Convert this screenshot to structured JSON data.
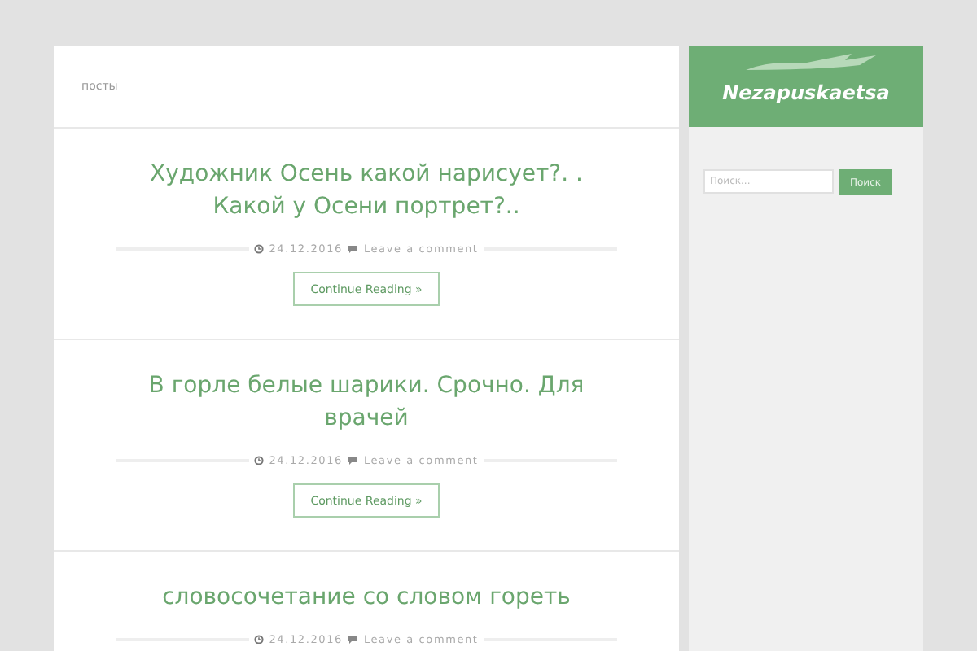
{
  "header": {
    "breadcrumb": "посты"
  },
  "posts": [
    {
      "title": "Художник Осень какой нарисует?. . Какой у Осени портрет?..",
      "date": "24.12.2016",
      "comments": "Leave a comment",
      "button": "Continue Reading »"
    },
    {
      "title": "В горле белые шарики. Срочно. Для врачей",
      "date": "24.12.2016",
      "comments": "Leave a comment",
      "button": "Continue Reading »"
    },
    {
      "title": "словосочетание со словом гореть",
      "date": "24.12.2016",
      "comments": "Leave a comment"
    }
  ],
  "sidebar": {
    "logo": "Nezapuskaetsa",
    "search": {
      "placeholder": "Поиск...",
      "button": "Поиск"
    }
  }
}
